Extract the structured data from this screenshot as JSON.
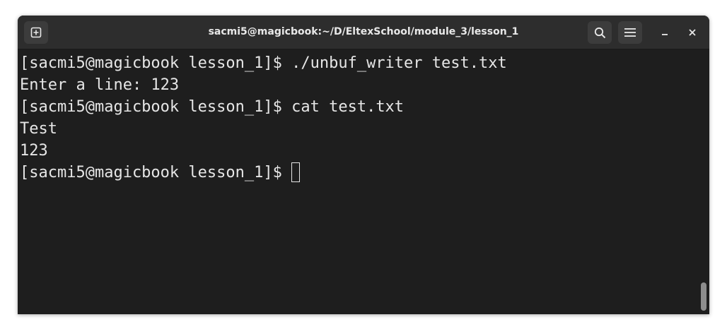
{
  "window": {
    "title": "sacmi5@magicbook:~/D/EltexSchool/module_3/lesson_1"
  },
  "header_buttons": {
    "new_tab_icon": "new-tab-icon",
    "search_icon": "search-icon",
    "menu_icon": "hamburger-menu-icon",
    "minimize_icon": "minimize-icon",
    "close_icon": "close-icon"
  },
  "terminal": {
    "lines": [
      "[sacmi5@magicbook lesson_1]$ ./unbuf_writer test.txt",
      "Enter a line: 123",
      "[sacmi5@magicbook lesson_1]$ cat test.txt",
      "Test",
      "123"
    ],
    "prompt": "[sacmi5@magicbook lesson_1]$ "
  },
  "colors": {
    "terminal_bg": "#1e1e1e",
    "titlebar_bg": "#2d2d2d",
    "text": "#e6e6e6"
  }
}
